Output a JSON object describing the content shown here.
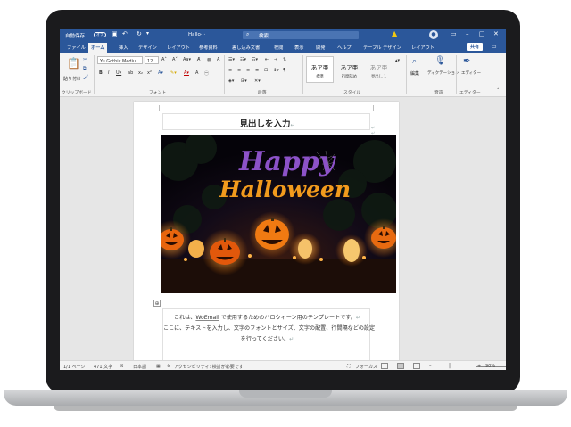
{
  "window": {
    "autosave_label": "自動保存",
    "autosave_state": "オフ",
    "doc_title": "Hallo···",
    "search_placeholder": "検索"
  },
  "tabs": [
    "ファイル",
    "ホーム",
    "挿入",
    "デザイン",
    "レイアウト",
    "参考資料",
    "差し込み文書",
    "校閲",
    "表示",
    "開発",
    "ヘルプ",
    "テーブル デザイン",
    "レイアウト"
  ],
  "active_tab": "ホーム",
  "share_label": "共有",
  "ribbon": {
    "clipboard": {
      "paste_label": "貼り付け",
      "group_label": "クリップボード"
    },
    "font": {
      "font_name": "Yu Gothic Mediu",
      "font_size": "12",
      "group_label": "フォント"
    },
    "paragraph": {
      "group_label": "段落"
    },
    "styles": {
      "group_label": "スタイル",
      "items": [
        {
          "sample": "あア亜",
          "name": "標準"
        },
        {
          "sample": "あア亜",
          "name": "行間詰め"
        },
        {
          "sample": "あア亜",
          "name": "見出し 1"
        }
      ]
    },
    "editing": {
      "label": "編集"
    },
    "voice": {
      "label": "ディクテーション",
      "group_label": "音声"
    },
    "editor": {
      "label": "エディター",
      "group_label": "エディター"
    }
  },
  "document": {
    "heading": "見出しを入力",
    "photo_text": {
      "line1": "Happy",
      "line2": "Halloween"
    },
    "body_lines": [
      [
        "これは、",
        "WoEmail",
        " で使用するためのハロウィーン用のテンプレートです。"
      ],
      "ここに、テキストを入力し、文字のフォントとサイズ、文字の配置、行間隔などの設定",
      "を行ってください。"
    ]
  },
  "status": {
    "page": "1/1 ページ",
    "words": "471 文字",
    "language": "日本語",
    "accessibility": "アクセシビリティ: 検討が必要です",
    "focus": "フォーカス",
    "zoom": "90%"
  },
  "colors": {
    "title_bar": "#2b579a",
    "ribbon_bg": "#f3f3f3",
    "happy_text": "#8c52c8",
    "halloween_text": "#f29b1d"
  },
  "icons": [
    "save-icon",
    "undo-icon",
    "redo-icon",
    "search-icon",
    "warning-icon",
    "user-icon",
    "minimize-icon",
    "maximize-icon",
    "close-icon",
    "comment-icon",
    "microphone-icon",
    "editor-pen-icon"
  ]
}
